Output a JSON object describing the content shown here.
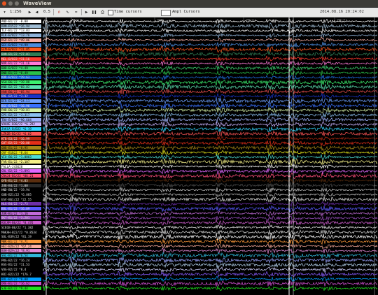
{
  "window": {
    "title": "WaveView"
  },
  "toolbar": {
    "scale": "1:256",
    "gain": "0.5",
    "time_cursors": "Time cursors",
    "ampl_cursors": "Ampl Cursors",
    "datetime": "2014.08.16 20:24:02"
  },
  "timeline": {
    "ticks": [
      "19(W)",
      "20",
      "20(1)",
      "20(2)"
    ]
  },
  "channels": [
    {
      "label": "AND-B1/22 -B.08",
      "color": "#ffffff",
      "trace": "#ffffff"
    },
    {
      "label": "RRN-R1522 *26.94",
      "color": "#9fbcd4",
      "trace": "#9fbcd4"
    },
    {
      "label": "TLF-B1/22 *13.83",
      "color": "#ffffff",
      "trace": "#ffffff"
    },
    {
      "label": "RLK-B/B22 *13.76",
      "color": "#8fb3d9",
      "trace": "#8fb3d9"
    },
    {
      "label": "RGD-B1/22 *49.06",
      "color": "#f7b0a6",
      "trace": "#f7b0a6"
    },
    {
      "label": "SEC-B/B22 *4.99",
      "color": "#4b8ee0",
      "trace": "#4b8ee0"
    },
    {
      "label": "GIM-B/B22 *21.85",
      "color": "#ff5a1f",
      "trace": "#ff5a1f"
    },
    {
      "label": "BON-B1/22 *27.01",
      "color": "#2f7b54",
      "trace": "#2f7b54"
    },
    {
      "label": "MEL-B/B22 *31.16",
      "color": "#ff3b2f",
      "trace": "#ff3b2f"
    },
    {
      "label": "NOR-B1/22 *31.16",
      "color": "#ff7ad9",
      "trace": "#ff7ad9"
    },
    {
      "label": "BBB-B/B22 *4.49",
      "color": "#3bd16f",
      "trace": "#3bd16f"
    },
    {
      "label": "DNB-B1/22 *8.49",
      "color": "#2abf4a",
      "trace": "#2abf4a"
    },
    {
      "label": "KBR-B/B22 *29.63",
      "color": "#1e6fe0",
      "trace": "#1e6fe0"
    },
    {
      "label": "VGH-B6/22 *39.88",
      "color": "#3bf06e",
      "trace": "#3bf06e"
    },
    {
      "label": "KNB-B2/22 *68.82",
      "color": "#5ce0b0",
      "trace": "#5ce0b0"
    },
    {
      "label": "HAN-B6/22 *85.94",
      "color": "#e84e4e",
      "trace": "#e84e4e"
    },
    {
      "label": "BRE-B2/22 *3.32",
      "color": "#1a34c8",
      "trace": "#1a34c8"
    },
    {
      "label": "DIR-B1/22 *24.11",
      "color": "#6ea0ff",
      "trace": "#6ea0ff"
    },
    {
      "label": "BSC-B/B22 *16.96",
      "color": "#3a73ff",
      "trace": "#3a73ff"
    },
    {
      "label": "PUB-B6/22 *10.81",
      "color": "#d3f0a8",
      "trace": "#d3f0a8"
    },
    {
      "label": "GPS-B2/22 *3.317",
      "color": "#8bc0f0",
      "trace": "#8bc0f0"
    },
    {
      "label": "TBU-B/B22 *90.604",
      "color": "#9fb3ff",
      "trace": "#9fb3ff"
    },
    {
      "label": "VOHXE-B30/22 *6.292",
      "color": "#c9b3ff",
      "trace": "#c9b3ff"
    },
    {
      "label": "JAKCA-B/B22 *6.19",
      "color": "#33d6ff",
      "trace": "#33d6ff"
    },
    {
      "label": "LZRZB-B2/22 *6.02",
      "color": "#ff5555",
      "trace": "#ff5555"
    },
    {
      "label": "KTB-B3/22 *16.99",
      "color": "#b62a12",
      "trace": "#b62a12"
    },
    {
      "label": "GUT-B2/22 *20.00",
      "color": "#e53019",
      "trace": "#e53019"
    },
    {
      "label": "OBB-B1/22 *0.95",
      "color": "#a58617",
      "trace": "#a58617"
    },
    {
      "label": "GRF-B1B22 *8.64",
      "color": "#e6e619",
      "trace": "#e6e619"
    },
    {
      "label": "VIO-B6/22 *1.0803",
      "color": "#4fe0d7",
      "trace": "#4fe0d7"
    },
    {
      "label": "FAR-B1/22 *2.107",
      "color": "#f4f088",
      "trace": "#f4f088"
    },
    {
      "label": "FALLA-J43620",
      "color": "#ffffff",
      "trace": "#ffffff"
    },
    {
      "label": "GRL-B2/22 *1.891",
      "color": "#e068ff",
      "trace": "#e068ff"
    },
    {
      "label": "CRAJ4-B1/22 *86.21",
      "color": "#ff4f7b",
      "trace": "#ff4f7b"
    },
    {
      "label": "OYB-B1/22 *4.03",
      "color": "#5a2e0f",
      "trace": "#5a2e0f"
    },
    {
      "label": "JUB-B4/22 *1.00",
      "color": "#2a2a2a",
      "trace": "#4d4d4d"
    },
    {
      "label": "HND-B0/22 *19.94",
      "color": "#000000",
      "trace": "#c9c9c9"
    },
    {
      "label": "GOB-B21/22 *6.085",
      "color": "#000000",
      "trace": "#b7b7b7"
    },
    {
      "label": "ESV-B61/22 *22.55",
      "color": "#000000",
      "trace": "#dcdcdc"
    },
    {
      "label": "HLG-B4/22 *2.73",
      "color": "#6d2fa9",
      "trace": "#6d2fa9"
    },
    {
      "label": "BOL-B1/22 *16.09",
      "color": "#5a5aff",
      "trace": "#5a5aff"
    },
    {
      "label": "ZUR-B1/22 *1.16",
      "color": "#c06bd8",
      "trace": "#c06bd8"
    },
    {
      "label": "SKT-B1/22 *3.201",
      "color": "#9a4fbf",
      "trace": "#9a4fbf"
    },
    {
      "label": "KOCAM-B0/22 *0.476",
      "color": "#d15fd1",
      "trace": "#d15fd1"
    },
    {
      "label": "SIB1B-B0/22 *1.382",
      "color": "#000000",
      "trace": "#ececec"
    },
    {
      "label": "MAKAH-B22/22 *0.8534",
      "color": "#000000",
      "trace": "#d8d8d8"
    },
    {
      "label": "SOL-B39/22 *81.19",
      "color": "#000000",
      "trace": "#ffffff"
    },
    {
      "label": "MBR-B1/22 *4.71",
      "color": "#ff9a3a",
      "trace": "#ff9a3a"
    },
    {
      "label": "HEI-B26/22 *67.24",
      "color": "#ffb0a0",
      "trace": "#ffb0a0"
    },
    {
      "label": "BUH-B29/22 *8.91",
      "color": "#e38ad6",
      "trace": "#e38ad6"
    },
    {
      "label": "SAL-B1/22 *6.54",
      "color": "#30b8d8",
      "trace": "#30b8d8"
    },
    {
      "label": "PRG-B2/22 *16.24",
      "color": "#000000",
      "trace": "#9aa6ff"
    },
    {
      "label": "KAS-B1/22 *11.53",
      "color": "#000000",
      "trace": "#b8d7f2"
    },
    {
      "label": "VOG-B2/22 *8.4",
      "color": "#000000",
      "trace": "#d2d2ff"
    },
    {
      "label": "KRI-B22/22 *176.7",
      "color": "#000000",
      "trace": "#8a5cff"
    },
    {
      "label": "BUL-B2/22 *0.88",
      "color": "#00a0ff",
      "trace": "#00a0ff"
    },
    {
      "label": "DRE-B1/22 *16.62",
      "color": "#d04fd0",
      "trace": "#d04fd0"
    },
    {
      "label": "SJE-B2/22 *9.44",
      "color": "#20e020",
      "trace": "#20e020"
    }
  ]
}
